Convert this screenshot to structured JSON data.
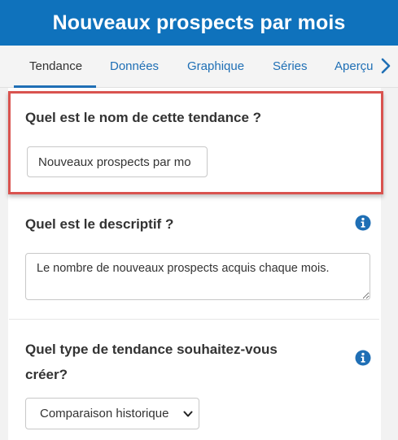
{
  "header": {
    "title": "Nouveaux prospects par mois"
  },
  "tabs": [
    {
      "label": "Tendance",
      "active": true
    },
    {
      "label": "Données",
      "active": false
    },
    {
      "label": "Graphique",
      "active": false
    },
    {
      "label": "Séries",
      "active": false
    },
    {
      "label": "Aperçu",
      "active": false
    }
  ],
  "name_section": {
    "question": "Quel est le nom de cette tendance ?",
    "value": "Nouveaux prospects par mo"
  },
  "description_section": {
    "question": "Quel est le descriptif ?",
    "value": "Le nombre de nouveaux prospects acquis chaque mois."
  },
  "type_section": {
    "question_line1": "Quel type de tendance souhaitez-vous",
    "question_line2": "créer?",
    "selected": "Comparaison historique"
  },
  "colors": {
    "header_bg": "#0f72bc",
    "accent": "#1f6fb5",
    "highlight_border": "#d9534f"
  },
  "icons": {
    "tab_scroll": "chevron-right-icon",
    "info": "info-icon",
    "select": "chevron-down-icon"
  }
}
